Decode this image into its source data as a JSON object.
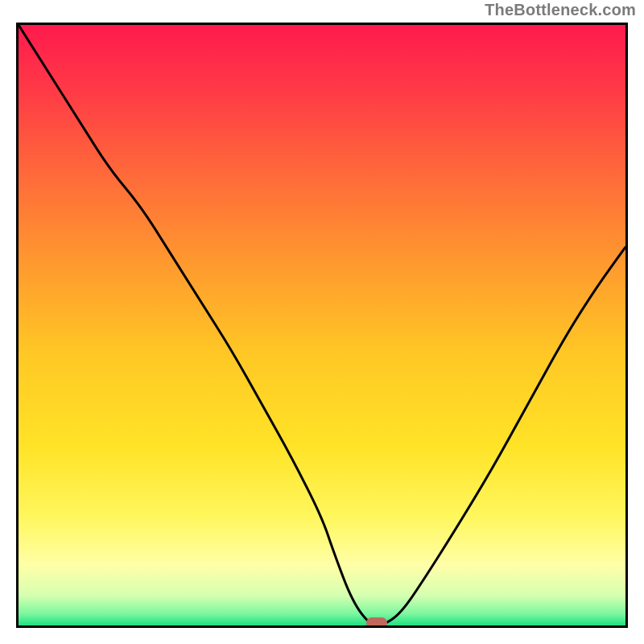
{
  "watermark": "TheBottleneck.com",
  "chart_data": {
    "type": "line",
    "title": "",
    "xlabel": "",
    "ylabel": "",
    "xlim": [
      0,
      100
    ],
    "ylim": [
      0,
      100
    ],
    "grid": false,
    "gradient_stops": [
      {
        "pos": 0,
        "color": "#ff1a4d"
      },
      {
        "pos": 10,
        "color": "#ff3747"
      },
      {
        "pos": 25,
        "color": "#ff6a3a"
      },
      {
        "pos": 40,
        "color": "#ff9a2e"
      },
      {
        "pos": 55,
        "color": "#ffc825"
      },
      {
        "pos": 70,
        "color": "#ffe327"
      },
      {
        "pos": 82,
        "color": "#fff75e"
      },
      {
        "pos": 90,
        "color": "#ffffa8"
      },
      {
        "pos": 95,
        "color": "#d6ffb0"
      },
      {
        "pos": 98,
        "color": "#7ef8a0"
      },
      {
        "pos": 100,
        "color": "#1ee082"
      }
    ],
    "series": [
      {
        "name": "bottleneck-curve",
        "x": [
          0,
          5,
          10,
          15,
          20,
          25,
          30,
          35,
          40,
          45,
          50,
          52,
          55,
          58,
          60,
          63,
          67,
          72,
          78,
          84,
          90,
          95,
          100
        ],
        "y": [
          100,
          92,
          84,
          76,
          70,
          62,
          54,
          46,
          37,
          28,
          18,
          12,
          4,
          0,
          0,
          2,
          8,
          16,
          26,
          37,
          48,
          56,
          63
        ]
      }
    ],
    "marker": {
      "x": 59,
      "y": 0,
      "color": "#c1675d"
    }
  }
}
